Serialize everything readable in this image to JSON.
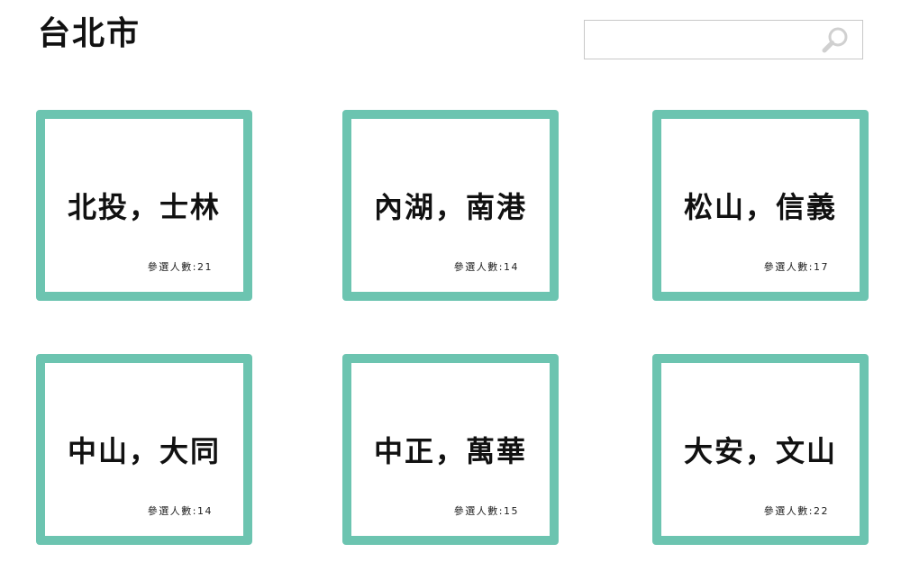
{
  "header": {
    "title": "台北市"
  },
  "search": {
    "value": "",
    "placeholder": "",
    "icon": "search-icon"
  },
  "colors": {
    "card_border": "#6cc4b0",
    "text": "#111111",
    "search_border": "#c8c8c8",
    "search_icon": "#d0d0d0"
  },
  "districts": [
    {
      "name": "北投，士林",
      "count_label": "參選人數:21"
    },
    {
      "name": "內湖，南港",
      "count_label": "參選人數:14"
    },
    {
      "name": "松山，信義",
      "count_label": "參選人數:17"
    },
    {
      "name": "中山，大同",
      "count_label": "參選人數:14"
    },
    {
      "name": "中正，萬華",
      "count_label": "參選人數:15"
    },
    {
      "name": "大安，文山",
      "count_label": "參選人數:22"
    }
  ]
}
